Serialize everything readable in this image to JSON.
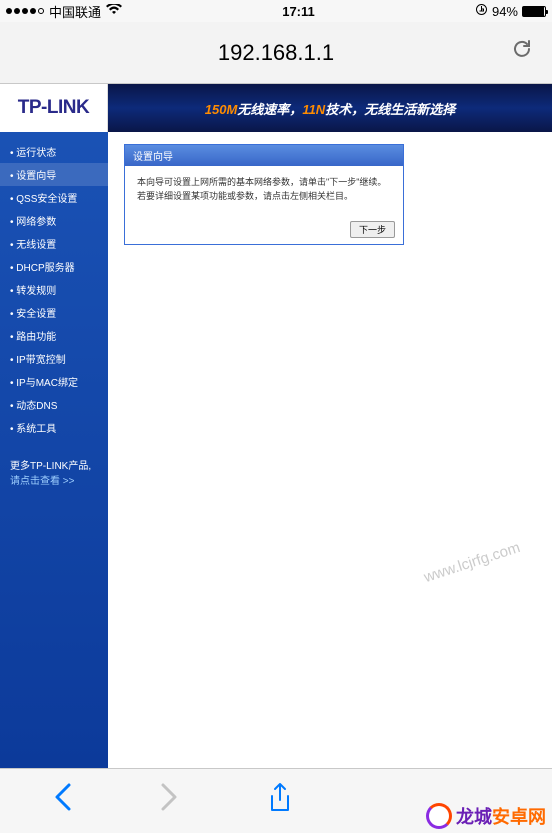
{
  "status": {
    "carrier": "中国联通",
    "time": "17:11",
    "battery_pct": "94%"
  },
  "browser": {
    "url": "192.168.1.1"
  },
  "router": {
    "logo": "TP-LINK",
    "banner_part1": "150M",
    "banner_part2": "无线速率，",
    "banner_part3": "11N",
    "banner_part4": "技术，无线生活新选择",
    "sidebar": {
      "items": [
        {
          "label": "运行状态"
        },
        {
          "label": "设置向导"
        },
        {
          "label": "QSS安全设置"
        },
        {
          "label": "网络参数"
        },
        {
          "label": "无线设置"
        },
        {
          "label": "DHCP服务器"
        },
        {
          "label": "转发规则"
        },
        {
          "label": "安全设置"
        },
        {
          "label": "路由功能"
        },
        {
          "label": "IP带宽控制"
        },
        {
          "label": "IP与MAC绑定"
        },
        {
          "label": "动态DNS"
        },
        {
          "label": "系统工具"
        }
      ],
      "extra_line1": "更多TP-LINK产品,",
      "extra_line2": "请点击查看 >>"
    },
    "panel": {
      "title": "设置向导",
      "body": "本向导可设置上网所需的基本网络参数，请单击\"下一步\"继续。若要详细设置某项功能或参数，请点击左侧相关栏目。",
      "next_label": "下一步"
    }
  },
  "watermark": {
    "url_text": "www.lcjrfg.com",
    "brand": "龙城安卓网"
  }
}
